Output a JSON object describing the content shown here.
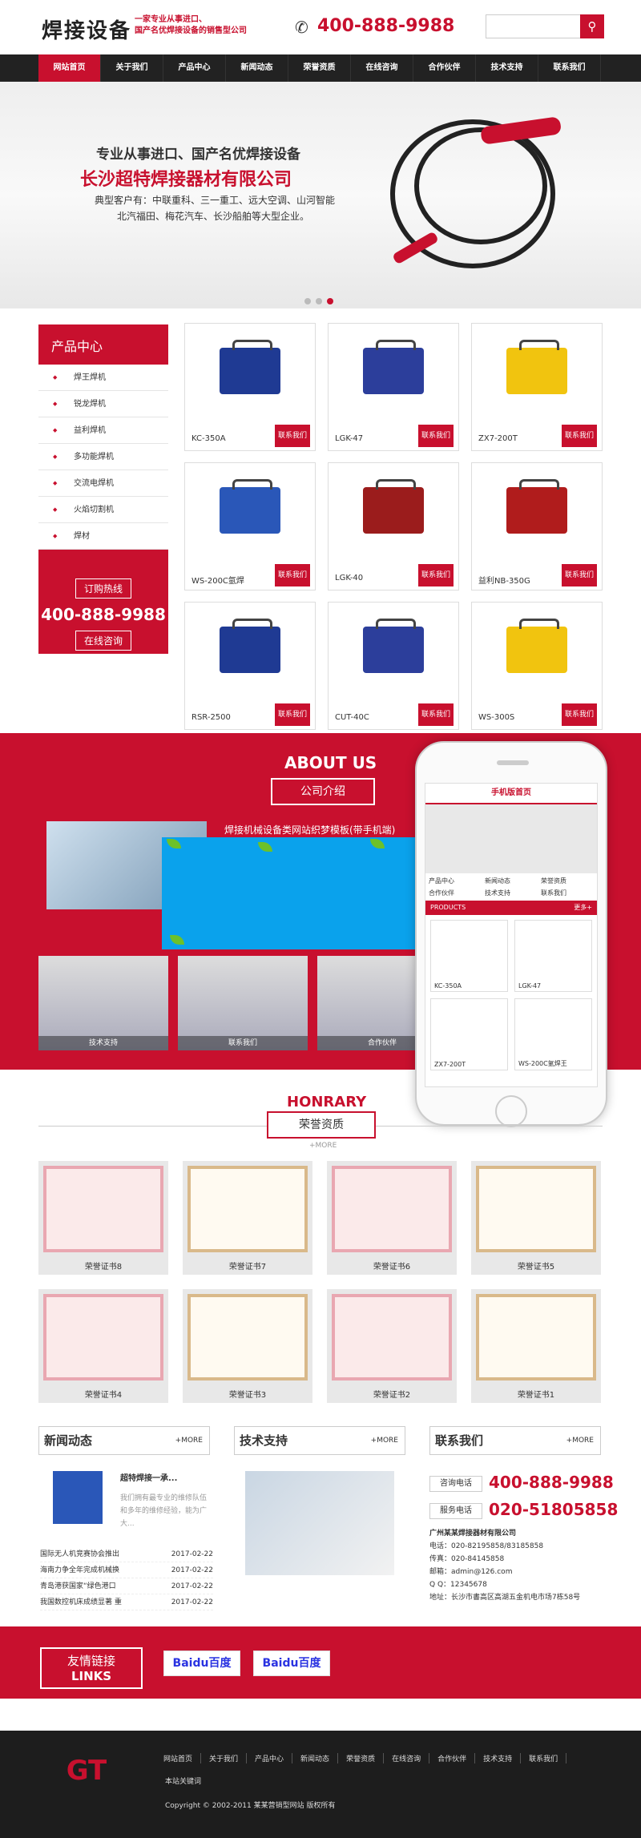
{
  "header": {
    "logo": "焊接设备",
    "slogan_1": "一家专业从事进口、",
    "slogan_2": "国产名优焊接设备的销售型公司",
    "phone": "400-888-9988"
  },
  "nav": [
    "网站首页",
    "关于我们",
    "产品中心",
    "新闻动态",
    "荣誉资质",
    "在线咨询",
    "合作伙伴",
    "技术支持",
    "联系我们"
  ],
  "banner": {
    "line1": "专业从事进口、国产名优焊接设备",
    "line2": "长沙超特焊接器材有限公司",
    "line3": "典型客户有：中联重科、三一重工、远大空调、山河智能",
    "line4": "北汽福田、梅花汽车、长沙船舶等大型企业。"
  },
  "sidebar": {
    "title": "产品中心",
    "items": [
      "焊王焊机",
      "锐龙焊机",
      "益利焊机",
      "多功能焊机",
      "交流电焊机",
      "火焰切割机",
      "焊材"
    ],
    "order_label": "订购热线",
    "hotline": "400-888-9988",
    "consult_label": "在线咨询"
  },
  "products": [
    {
      "name": "KC-350A",
      "color": "#1f3a93"
    },
    {
      "name": "LGK-47",
      "color": "#2c3e9b"
    },
    {
      "name": "ZX7-200T",
      "color": "#f1c40f"
    },
    {
      "name": "WS-200C氩焊",
      "color": "#2a57b8"
    },
    {
      "name": "LGK-40",
      "color": "#9b1c1c"
    },
    {
      "name": "益利NB-350G",
      "color": "#b01c1c"
    },
    {
      "name": "RSR-2500",
      "color": "#1f3a93"
    },
    {
      "name": "CUT-40C",
      "color": "#2c3e9b"
    },
    {
      "name": "WS-300S",
      "color": "#f1c40f"
    }
  ],
  "contact_btn": "联系我们",
  "about": {
    "title": "ABOUT US",
    "sub": "公司介绍",
    "text": "焊接机械设备类网站织梦模板(带手机端)",
    "thumbs": [
      "技术支持",
      "联系我们",
      "合作伙伴"
    ]
  },
  "mobile": {
    "head": "手机版首页",
    "nav": [
      "产品中心",
      "新闻动态",
      "荣誉资质",
      "合作伙伴",
      "技术支持",
      "联系我们"
    ],
    "bar": "PRODUCTS",
    "more": "更多+",
    "items": [
      "KC-350A",
      "LGK-47",
      "ZX7-200T",
      "WS-200C氩焊王"
    ]
  },
  "honor": {
    "title": "HONRARY",
    "sub": "荣誉资质",
    "more": "+MORE",
    "certs": [
      "荣誉证书8",
      "荣誉证书7",
      "荣誉证书6",
      "荣誉证书5",
      "荣誉证书4",
      "荣誉证书3",
      "荣誉证书2",
      "荣誉证书1"
    ]
  },
  "news": {
    "title": "新闻动态",
    "more": "+MORE",
    "head": "超特焊接一承...",
    "desc": "我们拥有最专业的维修队伍和多年的维修经验，能为广大...",
    "list": [
      {
        "t": "国际无人机竞赛协会推出",
        "d": "2017-02-22"
      },
      {
        "t": "海南力争全年完成机械换",
        "d": "2017-02-22"
      },
      {
        "t": "青岛港获国家“绿色港口",
        "d": "2017-02-22"
      },
      {
        "t": "我国数控机床成绩显著 重",
        "d": "2017-02-22"
      }
    ]
  },
  "tech": {
    "title": "技术支持",
    "more": "+MORE"
  },
  "contact": {
    "title": "联系我们",
    "more": "+MORE",
    "tag1": "咨询电话",
    "val1": "400-888-9988",
    "tag2": "服务电话",
    "val2": "020-51805858",
    "company": "广州某某焊接器材有限公司",
    "tel": "电话：020-82195858/83185858",
    "fax": "传真：020-84145858",
    "email": "邮箱：admin@126.com",
    "qq": "Q Q：12345678",
    "addr": "地址：长沙市書高区高湖五金机电市场7栋58号"
  },
  "links": {
    "title": "友情链接",
    "sub": "LINKS",
    "baidu": "Baidu百度"
  },
  "footer": {
    "nav": [
      "网站首页",
      "关于我们",
      "产品中心",
      "新闻动态",
      "荣誉资质",
      "在线咨询",
      "合作伙伴",
      "技术支持",
      "联系我们"
    ],
    "keywords": "本站关键词",
    "copyright": "Copyright © 2002-2011 某某营销型网站 版权所有"
  }
}
